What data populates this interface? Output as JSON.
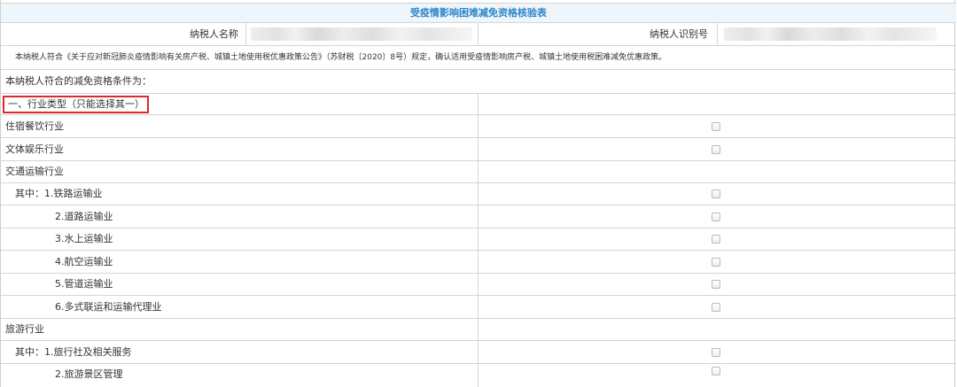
{
  "form": {
    "title": "受疫情影响困难减免资格核验表",
    "taxpayer_name_label": "纳税人名称",
    "taxpayer_id_label": "纳税人识别号",
    "notice": "本纳税人符合《关于应对新冠肺炎疫情影响有关房产税、城镇土地使用税优惠政策公告》（苏财税〔2020〕8号）规定，确认适用受疫情影响房产税、城镇土地使用税困难减免优惠政策。",
    "conditions_intro": "本纳税人符合的减免资格条件为：",
    "section_industry": "一、行业类型（只能选择其一）",
    "items": [
      {
        "label": "住宿餐饮行业",
        "checked": false
      },
      {
        "label": "文体娱乐行业",
        "checked": false
      },
      {
        "label": "交通运输行业"
      },
      {
        "label": "其中：1.铁路运输业",
        "checked": false
      },
      {
        "label": "2.道路运输业",
        "checked": false
      },
      {
        "label": "3.水上运输业",
        "checked": false
      },
      {
        "label": "4.航空运输业",
        "checked": false
      },
      {
        "label": "5.管道运输业",
        "checked": false
      },
      {
        "label": "6.多式联运和运输代理业",
        "checked": false
      },
      {
        "label": "旅游行业"
      },
      {
        "label": "其中：1.旅行社及相关服务",
        "checked": false
      },
      {
        "label": "2.旅游景区管理",
        "checked": false
      }
    ]
  },
  "colors": {
    "title_text": "#2d86c9",
    "title_bg": "#eef5fb",
    "highlight_border": "#e02828"
  }
}
